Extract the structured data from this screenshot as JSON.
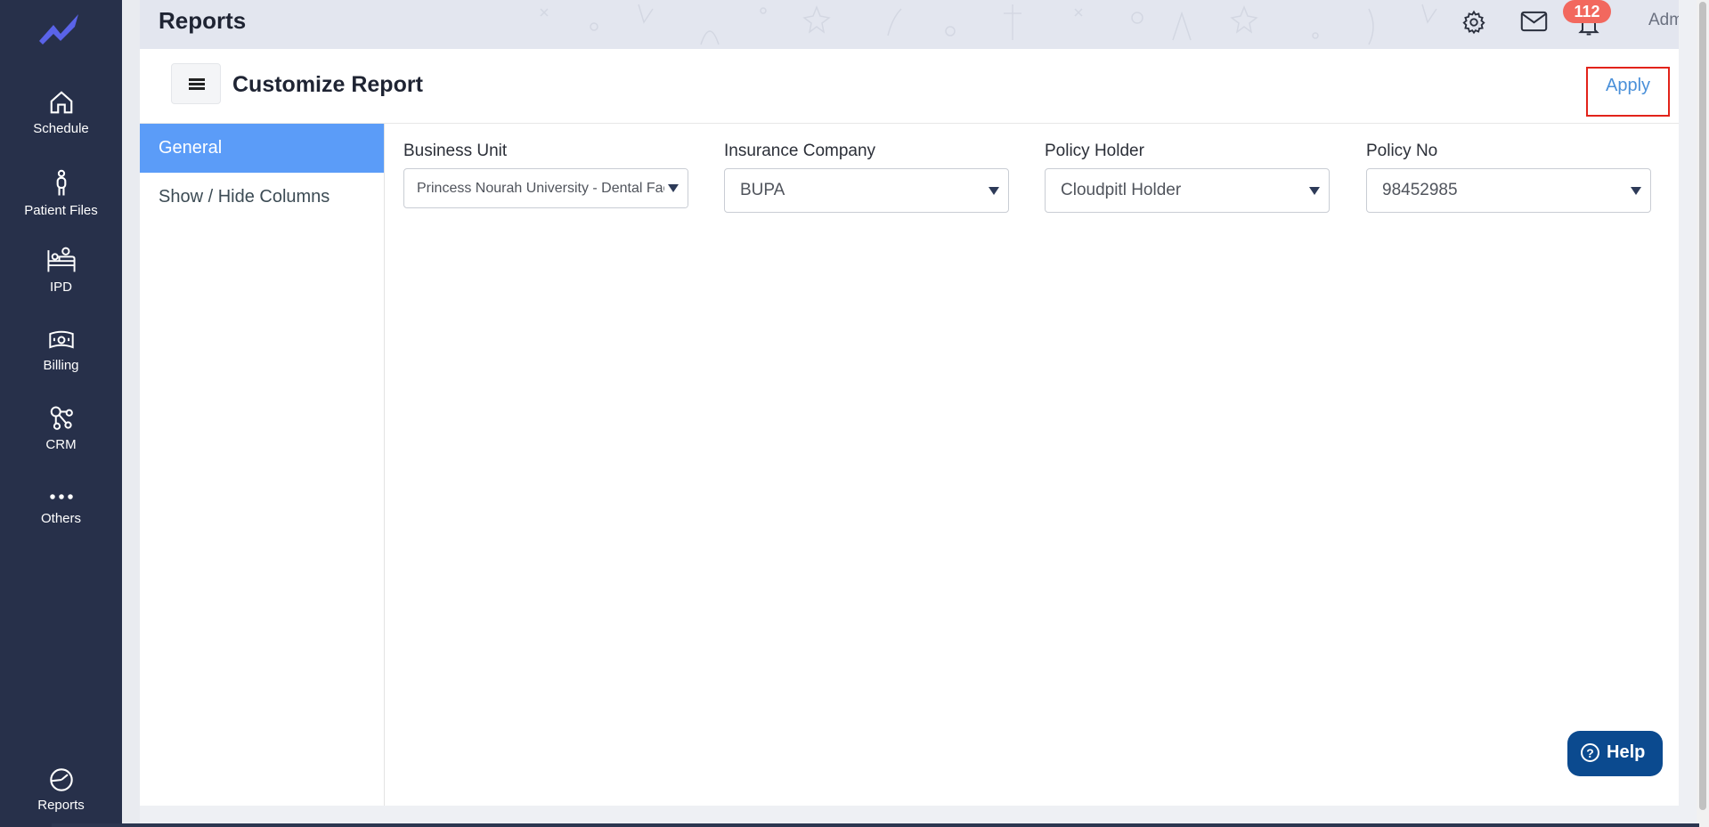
{
  "sidebar": {
    "items": [
      {
        "label": "Schedule",
        "icon": "home-icon"
      },
      {
        "label": "Patient Files",
        "icon": "person-icon"
      },
      {
        "label": "IPD",
        "icon": "bed-icon"
      },
      {
        "label": "Billing",
        "icon": "money-icon"
      },
      {
        "label": "CRM",
        "icon": "network-icon"
      },
      {
        "label": "Others",
        "icon": "more-dots-icon"
      },
      {
        "label": "Reports",
        "icon": "reports-chart-icon"
      }
    ]
  },
  "header": {
    "title": "Reports",
    "notification_count": "112",
    "user_name": "Administrator"
  },
  "panel": {
    "title": "Customize Report",
    "apply_label": "Apply",
    "nav": [
      {
        "label": "General",
        "active": true
      },
      {
        "label": "Show / Hide Columns",
        "active": false
      }
    ]
  },
  "filters": {
    "business_unit": {
      "label": "Business Unit",
      "value": "Princess Nourah University - Dental Faculty"
    },
    "insurance_company": {
      "label": "Insurance Company",
      "value": "BUPA"
    },
    "policy_holder": {
      "label": "Policy Holder",
      "value": "Cloudpitl Holder"
    },
    "policy_no": {
      "label": "Policy No",
      "value": "98452985"
    }
  },
  "help": {
    "label": "Help"
  },
  "colors": {
    "sidebar_bg": "#27304a",
    "active_tab": "#5b9cf8",
    "apply_link": "#4a90d9",
    "badge": "#f2685e",
    "help_button": "#0b4a8f",
    "highlight_box": "#e2231a"
  }
}
